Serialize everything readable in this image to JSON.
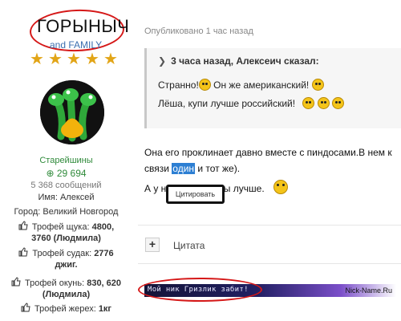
{
  "user": {
    "name": "ГОРЫНЫЧ",
    "family": "and FAMILY",
    "rank": "Старейшины",
    "reputation": "29 694",
    "posts": "5 368 сообщений",
    "real_name": "Имя: Алексей",
    "city": "Город:   Великий Новгород",
    "trophies": [
      {
        "line1_label": "Трофей щука: ",
        "line1_value": "4800,",
        "line2": "3760 (Людмила)"
      },
      {
        "line1_label": "Трофей судак: ",
        "line1_value": "2776",
        "line2": "джиг."
      },
      {
        "line1_label": "Трофей окунь: ",
        "line1_value": "830, 620",
        "line2": "(Людмила)"
      },
      {
        "line1_label": "Трофей жерех: ",
        "line1_value": "1кг",
        "line2": ""
      }
    ],
    "stars_count": 5
  },
  "post": {
    "timestamp": "Опубликовано 1 час назад",
    "quote": {
      "header": "3 часа назад, Алексеич сказал:",
      "line1_a": "Странно!",
      "line1_b": " Он же американский!",
      "line2": "Лёша, купи лучше российский!"
    },
    "text_line1": "Она его проклинает давно вместе с пиндосами.В нем к",
    "text_line2_a": "связи ",
    "text_line2_hl": "один",
    "text_line2_b": " и тот же).",
    "text_line3_a": "А у н",
    "text_line3_b": "ты лучше."
  },
  "tooltip": {
    "label": "Цитировать"
  },
  "actions": {
    "plus": "+",
    "quote_label": "Цитата"
  },
  "signature": {
    "text": "Мой ник Гризлик забит!",
    "site": "Nick-Name.Ru"
  },
  "colors": {
    "accent_red": "#d51818",
    "rank_green": "#2f8a3a",
    "highlight_blue": "#2d7fd3",
    "family_blue": "#3c6fb0"
  },
  "icons": [
    "star-icon",
    "avatar-dragon",
    "reputation-plus-icon",
    "thumbs-up-icon",
    "quote-arrow-icon",
    "smiley-icon",
    "plus-icon"
  ]
}
